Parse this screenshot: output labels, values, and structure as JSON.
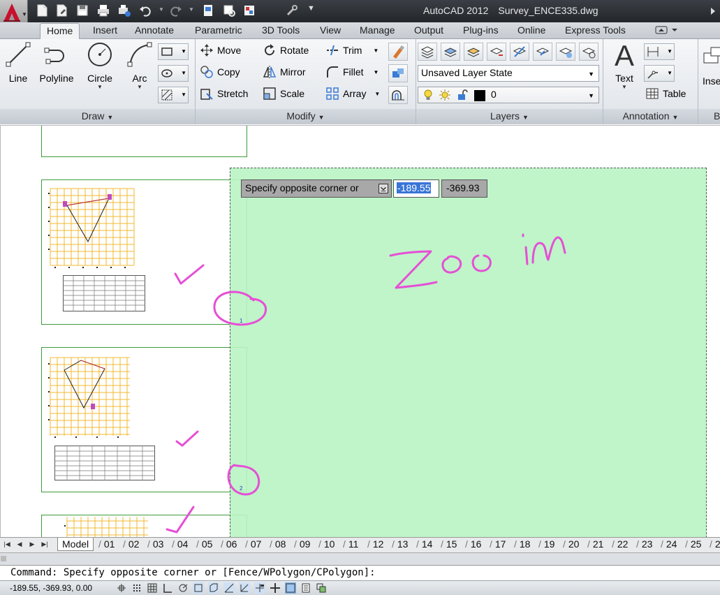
{
  "titlebar": {
    "app_name": "AutoCAD 2012",
    "file_name": "Survey_ENCE335.dwg"
  },
  "ribbon_tabs": [
    "Home",
    "Insert",
    "Annotate",
    "Parametric",
    "3D Tools",
    "View",
    "Manage",
    "Output",
    "Plug-ins",
    "Online",
    "Express Tools"
  ],
  "panels": {
    "draw": {
      "title": "Draw",
      "line": "Line",
      "polyline": "Polyline",
      "circle": "Circle",
      "arc": "Arc"
    },
    "modify": {
      "title": "Modify",
      "move": "Move",
      "rotate": "Rotate",
      "trim": "Trim",
      "copy": "Copy",
      "mirror": "Mirror",
      "fillet": "Fillet",
      "stretch": "Stretch",
      "scale": "Scale",
      "array": "Array"
    },
    "layers": {
      "title": "Layers",
      "layer_state": "Unsaved Layer State",
      "current_layer": "0",
      "layer_color": "#000000"
    },
    "annotation": {
      "title": "Annotation",
      "text": "Text",
      "table": "Table"
    },
    "block": {
      "insert": "Inse",
      "title": "B"
    }
  },
  "canvas": {
    "prompt": "Specify opposite corner or",
    "input_x": "-189.55",
    "input_y": "-369.93",
    "handwriting": "Zoo in",
    "ink_color": "#e64fd6",
    "selection_color": "#b9f5c4",
    "sheet_numbers": [
      "1",
      "2"
    ]
  },
  "layout_tabs": [
    "Model",
    "01",
    "02",
    "03",
    "04",
    "05",
    "06",
    "07",
    "08",
    "09",
    "10",
    "11",
    "12",
    "13",
    "14",
    "15",
    "16",
    "17",
    "18",
    "19",
    "20",
    "21",
    "22",
    "23",
    "24",
    "25",
    "2"
  ],
  "command": {
    "line": "Command: Specify opposite corner or [Fence/WPolygon/CPolygon]:"
  },
  "status": {
    "coordinates": "-189.55, -369.93, 0.00"
  }
}
